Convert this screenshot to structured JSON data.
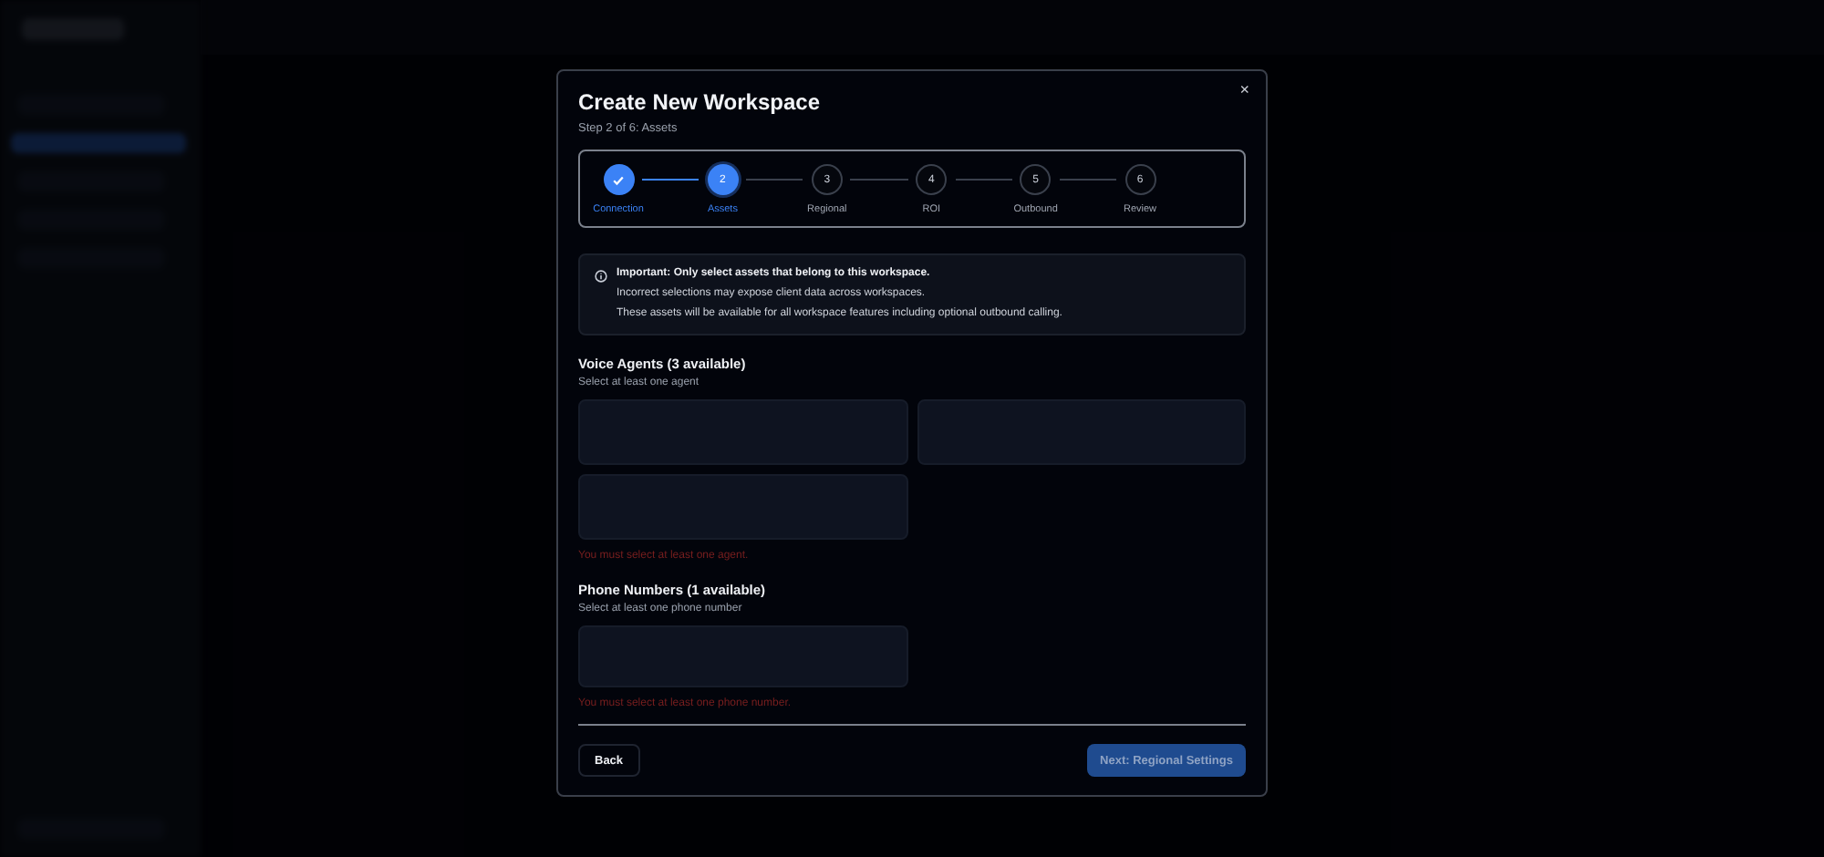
{
  "dialog": {
    "title": "Create New Workspace",
    "subtitle": "Step 2 of 6: Assets",
    "close": "×"
  },
  "steps": [
    {
      "label": "Connection",
      "completed": true,
      "selected": false
    },
    {
      "number": "2",
      "label": "Assets",
      "completed": false,
      "selected": true
    },
    {
      "number": "3",
      "label": "Regional",
      "completed": false,
      "selected": false
    },
    {
      "number": "4",
      "label": "ROI",
      "completed": false,
      "selected": false
    },
    {
      "number": "5",
      "label": "Outbound",
      "completed": false,
      "selected": false
    },
    {
      "number": "6",
      "label": "Review",
      "completed": false,
      "selected": false
    }
  ],
  "notice": {
    "heading": "Important: Only select assets that belong to this workspace.",
    "lines": [
      "Incorrect selections may expose client data across workspaces.",
      "These assets will be available for all workspace features including optional outbound calling."
    ]
  },
  "sections": [
    {
      "title": "Voice Agents (3 available)",
      "hint": "Select at least one agent",
      "options": [
        {
          "selected": false
        },
        {
          "selected": false
        },
        {
          "selected": false
        }
      ],
      "error": "You must select at least one agent."
    },
    {
      "title": "Phone Numbers (1 available)",
      "hint": "Select at least one phone number",
      "options": [
        {
          "selected": false
        }
      ],
      "error": "You must select at least one phone number."
    }
  ],
  "footer": {
    "back": "Back",
    "next": "Next: Regional Settings",
    "next_disabled": true
  }
}
